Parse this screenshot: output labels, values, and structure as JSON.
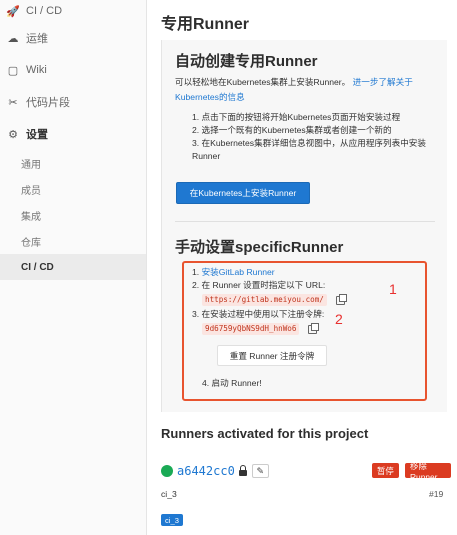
{
  "sidebar": {
    "items": [
      {
        "icon": "rocket-icon",
        "glyph": "🚀",
        "label": "CI / CD"
      },
      {
        "icon": "cloud-ops-icon",
        "glyph": "☁",
        "label": "运维"
      },
      {
        "icon": "book-icon",
        "glyph": "▢",
        "label": "Wiki"
      },
      {
        "icon": "scissors-icon",
        "glyph": "✂",
        "label": "代码片段"
      },
      {
        "icon": "gear-icon",
        "glyph": "⚙",
        "label": "设置"
      }
    ],
    "sub_items": [
      {
        "label": "通用"
      },
      {
        "label": "成员"
      },
      {
        "label": "集成"
      },
      {
        "label": "仓库"
      },
      {
        "label": "CI / CD"
      }
    ]
  },
  "main": {
    "page_title": "专用Runner",
    "auto": {
      "title": "自动创建专用Runner",
      "desc_text": "可以轻松地在Kubernetes集群上安装Runner。",
      "desc_link": "进一步了解关于Kubernetes的信息",
      "steps": [
        "1. 点击下面的按钮将开始Kubernetes页面开始安装过程",
        "2. 选择一个既有的Kubernetes集群或者创建一个新的",
        "3. 在Kubernetes集群详细信息视图中，从应用程序列表中安装Runner"
      ],
      "install_button": "在Kubernetes上安装Runner"
    },
    "manual": {
      "title": "手动设置specificRunner",
      "step1_prefix": "1. ",
      "step1_link": "安装GitLab Runner",
      "step2": "2. 在 Runner 设置时指定以下 URL:",
      "url": "https://gitlab.meiyou.com/",
      "step3": "3. 在安装过程中使用以下注册令牌:",
      "token": "9d6759yQbNS9dH_hnWo6",
      "reset_button": "重置 Runner 注册令牌",
      "step4": "4. 启动 Runner!",
      "annotation_1": "1",
      "annotation_2": "2"
    },
    "runners": {
      "title": "Runners activated for this project",
      "status_color": "#1aaa55",
      "runner_id": "a6442cc0",
      "pause_button": "暂停",
      "remove_button": "移除Runner",
      "description": "ci_3",
      "number": "#19",
      "tag": "ci_3"
    }
  }
}
